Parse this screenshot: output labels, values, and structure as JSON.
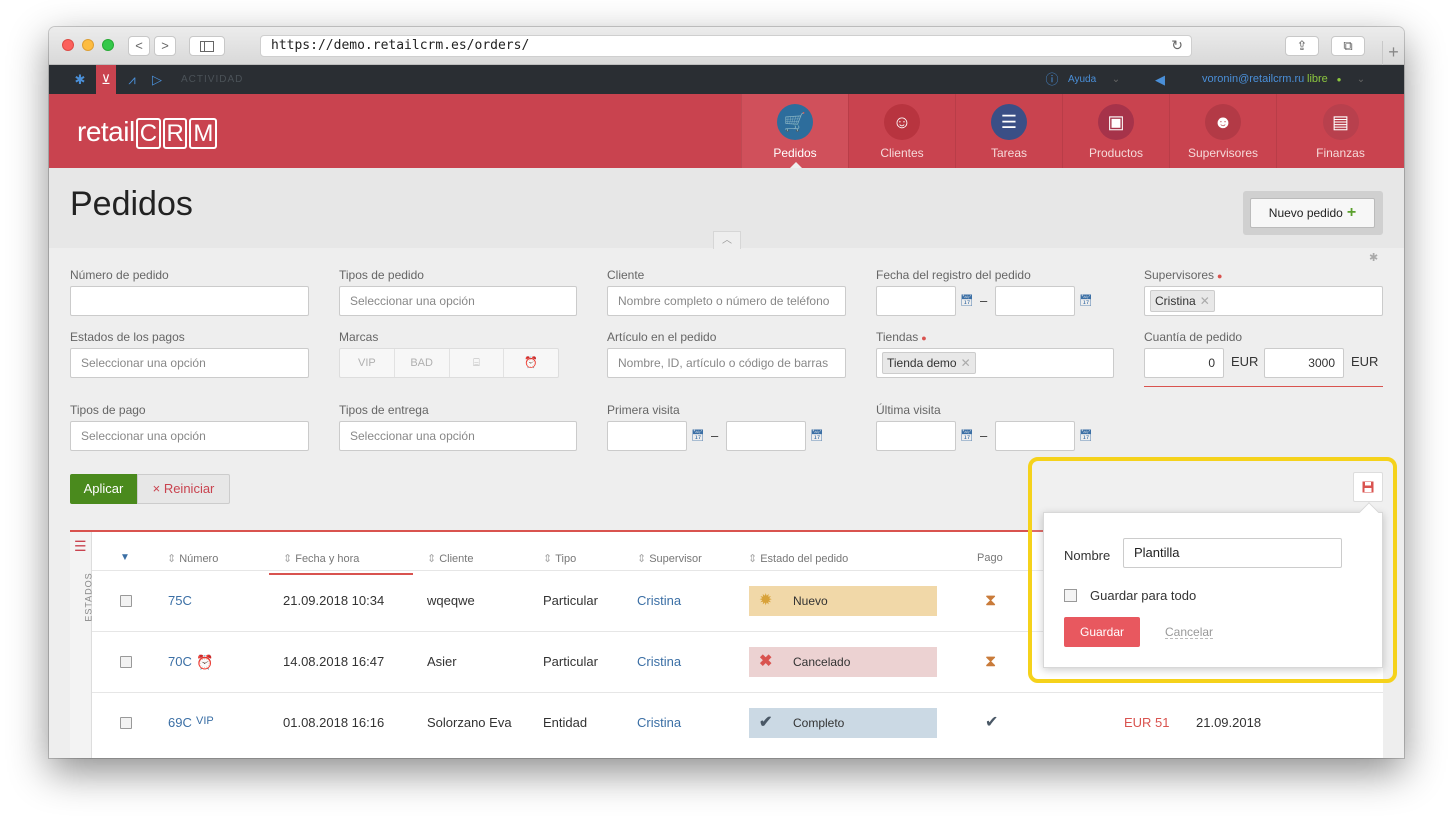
{
  "browser": {
    "url": "https://demo.retailcrm.es/orders/",
    "back_label": "<",
    "forward_label": ">",
    "reload_label": "↻",
    "share_label": "⇪",
    "tabs_label": "⧉",
    "newtab_label": "+"
  },
  "topnav": {
    "activity_label": "ACTIVIDAD",
    "help_label": "Ayuda",
    "user_email": "voronin@retailcrm.ru",
    "user_status": "libre"
  },
  "header": {
    "logo_text_a": "retail",
    "logo_c": "C",
    "logo_r": "R",
    "logo_m": "M",
    "nav": [
      {
        "label": "Pedidos",
        "icon": "cart-icon"
      },
      {
        "label": "Clientes",
        "icon": "customer-avatar-icon"
      },
      {
        "label": "Tareas",
        "icon": "tasks-icon"
      },
      {
        "label": "Productos",
        "icon": "box-icon"
      },
      {
        "label": "Supervisores",
        "icon": "supervisor-avatar-icon"
      },
      {
        "label": "Finanzas",
        "icon": "finance-icon"
      }
    ]
  },
  "page": {
    "title": "Pedidos",
    "new_order_label": "Nuevo pedido",
    "new_order_plus": "+"
  },
  "filters": {
    "order_number": {
      "label": "Número de pedido",
      "value": ""
    },
    "order_types": {
      "label": "Tipos de pedido",
      "placeholder": "Seleccionar una opción"
    },
    "client": {
      "label": "Cliente",
      "placeholder": "Nombre completo o número de teléfono"
    },
    "registration_date": {
      "label": "Fecha del registro del pedido"
    },
    "supervisors": {
      "label": "Supervisores",
      "tag": "Cristina"
    },
    "payment_states": {
      "label": "Estados de los pagos",
      "placeholder": "Seleccionar una opción"
    },
    "brands": {
      "label": "Marcas",
      "options": [
        "VIP",
        "BAD",
        "⌸",
        "⏰"
      ]
    },
    "article": {
      "label": "Artículo en el pedido",
      "placeholder": "Nombre, ID, artículo o código de barras"
    },
    "stores": {
      "label": "Tiendas",
      "tag": "Tienda demo"
    },
    "order_amount": {
      "label": "Cuantía de pedido",
      "from": "0",
      "to": "3000",
      "currency": "EUR"
    },
    "payment_types": {
      "label": "Tipos de pago",
      "placeholder": "Seleccionar una opción"
    },
    "delivery_types": {
      "label": "Tipos de entrega",
      "placeholder": "Seleccionar una opción"
    },
    "first_visit": {
      "label": "Primera visita"
    },
    "last_visit": {
      "label": "Última visita"
    },
    "apply_label": "Aplicar",
    "reset_label": "× Reiniciar",
    "dash": "–"
  },
  "table": {
    "sidebar_label": "ESTADOS",
    "headers": {
      "number": "Número",
      "datetime": "Fecha y hora",
      "client": "Cliente",
      "type": "Tipo",
      "supervisor": "Supervisor",
      "status": "Estado del pedido",
      "payment": "Pago"
    },
    "rows": [
      {
        "number": "75C",
        "badge": "",
        "datetime": "21.09.2018 10:34",
        "client": "wqeqwe",
        "type": "Particular",
        "supervisor": "Cristina",
        "status": "Nuevo",
        "status_color": "#f1d8a8",
        "status_icon": "lightbulb-icon",
        "payment_icon": "hourglass-icon",
        "price": "",
        "date2": ""
      },
      {
        "number": "70C",
        "badge": "⏰",
        "datetime": "14.08.2018 16:47",
        "client": "Asier",
        "type": "Particular",
        "supervisor": "Cristina",
        "status": "Cancelado",
        "status_color": "#ecd2d2",
        "status_icon": "cross-icon",
        "payment_icon": "hourglass-icon",
        "price": "",
        "date2": ""
      },
      {
        "number": "69C",
        "badge": "VIP",
        "datetime": "01.08.2018 16:16",
        "client": "Solorzano Eva",
        "type": "Entidad",
        "supervisor": "Cristina",
        "status": "Completo",
        "status_color": "#cbd9e4",
        "status_icon": "check-icon",
        "payment_icon": "check-icon",
        "price": "EUR 51",
        "date2": "21.09.2018"
      }
    ]
  },
  "save_filter_popup": {
    "name_label": "Nombre",
    "name_value": "Plantilla",
    "save_for_all_label": "Guardar para todo",
    "save_label": "Guardar",
    "cancel_label": "Cancelar"
  },
  "colors": {
    "header_red": "#c9434f",
    "highlight_yellow": "#f5d21b",
    "apply_green": "#4a8a1d"
  }
}
